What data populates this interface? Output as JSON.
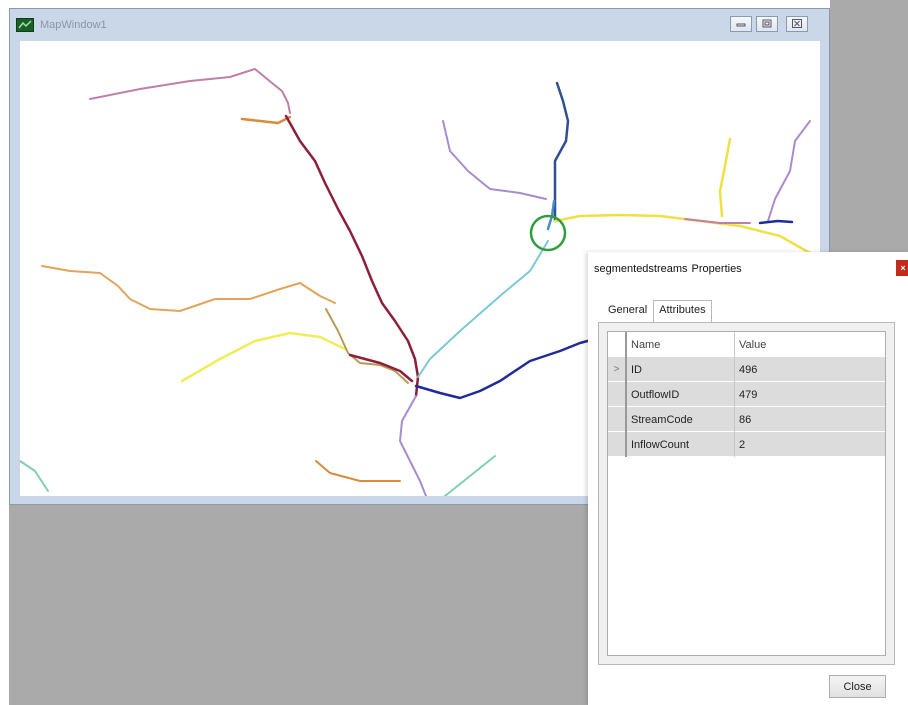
{
  "map_window": {
    "title": "MapWindow1",
    "icons": {
      "app": "map-app-icon",
      "minimize": "minimize-icon",
      "maximize": "maximize-icon",
      "close": "close-icon"
    },
    "highlight_color": "#2e9e3e"
  },
  "properties_dialog": {
    "layer_name": "segmentedstreams",
    "title_suffix": "Properties",
    "close_glyph": "×",
    "tabs": [
      {
        "label": "General",
        "active": false
      },
      {
        "label": "Attributes",
        "active": true
      }
    ],
    "grid": {
      "columns": [
        "Name",
        "Value"
      ],
      "current_row_marker": ">",
      "rows": [
        {
          "name": "ID",
          "value": "496"
        },
        {
          "name": "OutflowID",
          "value": "479"
        },
        {
          "name": "StreamCode",
          "value": "86"
        },
        {
          "name": "InflowCount",
          "value": "2"
        }
      ]
    },
    "close_button_label": "Close",
    "accent_close_color": "#c42b1c"
  }
}
